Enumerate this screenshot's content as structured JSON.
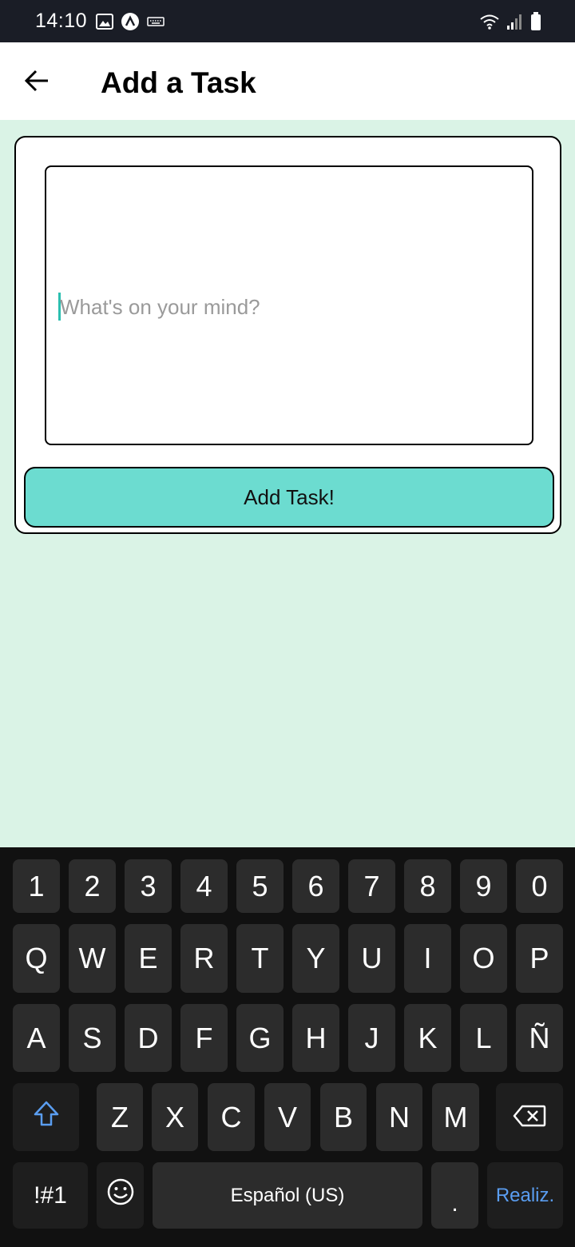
{
  "status_bar": {
    "time": "14:10",
    "left_icons": [
      "image-icon",
      "app-icon",
      "keyboard-icon"
    ],
    "right_icons": [
      "wifi-icon",
      "signal-icon",
      "battery-icon"
    ]
  },
  "app_bar": {
    "title": "Add a Task",
    "back_icon": "back-arrow-icon"
  },
  "task_form": {
    "input_placeholder": "What's on your mind?",
    "input_value": "",
    "submit_label": "Add Task!"
  },
  "keyboard": {
    "number_row": [
      "1",
      "2",
      "3",
      "4",
      "5",
      "6",
      "7",
      "8",
      "9",
      "0"
    ],
    "row1": [
      "Q",
      "W",
      "E",
      "R",
      "T",
      "Y",
      "U",
      "I",
      "O",
      "P"
    ],
    "row2": [
      "A",
      "S",
      "D",
      "F",
      "G",
      "H",
      "J",
      "K",
      "L",
      "Ñ"
    ],
    "row3": [
      "Z",
      "X",
      "C",
      "V",
      "B",
      "N",
      "M"
    ],
    "symbols_label": "!#1",
    "space_label": "Español (US)",
    "period_label": ".",
    "action_label": "Realiz."
  },
  "colors": {
    "background": "#daf3e6",
    "button": "#6cdcd0",
    "caret": "#2bbfb0",
    "keyboard_bg": "#111111",
    "key_bg": "#2c2c2c",
    "accent_blue": "#5a9df0"
  }
}
